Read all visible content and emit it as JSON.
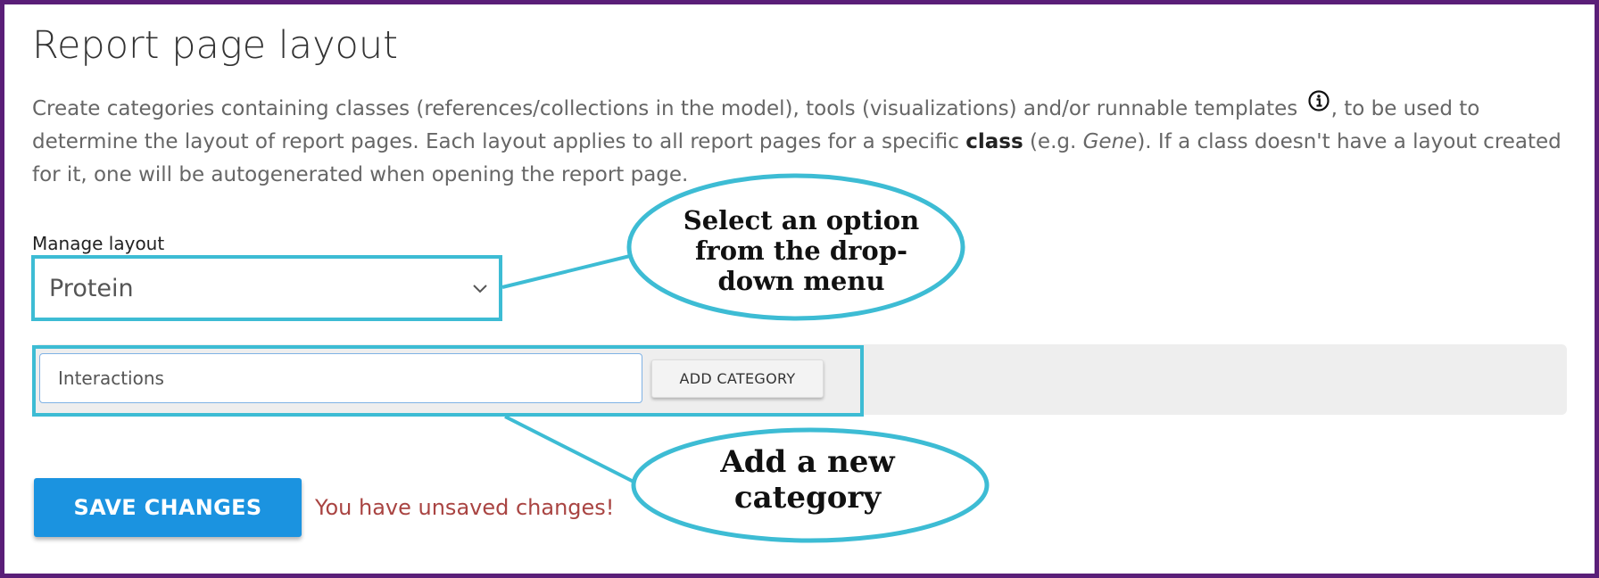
{
  "header": {
    "title": "Report page layout"
  },
  "description": {
    "part1": "Create categories containing classes (references/collections in the model), tools (visualizations) and/or runnable templates ",
    "part2": ", to be used to determine the layout of report pages. Each layout applies to all report pages for a specific ",
    "bold": "class",
    "part3": " (e.g. ",
    "italic": "Gene",
    "part4": "). If a class doesn't have a layout created for it, one will be autogenerated when opening the report page.",
    "info_icon": "info-circle-icon"
  },
  "manage_layout": {
    "label": "Manage layout",
    "selected": "Protein",
    "dropdown_icon": "chevron-down-icon"
  },
  "category": {
    "input_value": "Interactions",
    "add_label": "ADD CATEGORY"
  },
  "actions": {
    "save_label": "SAVE CHANGES",
    "unsaved_message": "You have unsaved changes!"
  },
  "callouts": {
    "select_hint": "Select an option from the drop-down menu",
    "add_hint": "Add a new category"
  },
  "colors": {
    "highlight": "#3dbcd4",
    "primary": "#1b93e0",
    "warning": "#a94442",
    "frame": "#5a1e78"
  }
}
